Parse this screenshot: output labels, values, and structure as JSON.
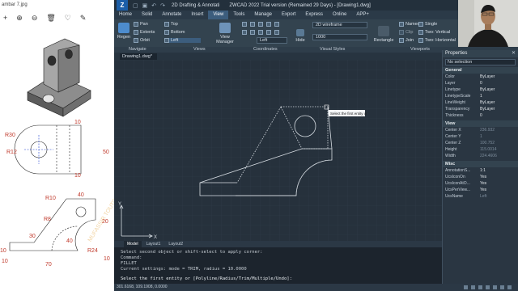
{
  "viewer": {
    "title": "ambar 7.jpg",
    "toolbar": [
      "+",
      "⊕",
      "⊖",
      "🗑",
      "♡",
      "✎"
    ]
  },
  "reference_drawing": {
    "dims": [
      "R30",
      "R12",
      "50",
      "10",
      "10",
      "R10",
      "40",
      "R8",
      "20",
      "30",
      "40",
      "10",
      "R24",
      "70",
      "10",
      "10"
    ],
    "watermark": "MUFASSIR TOUTOUR CHANNEL"
  },
  "cad": {
    "title": "ZWCAD 2022 Trial version (Remained 29 Days) - [Drawing1.dwg]",
    "workspace": "2D Drafting & Annotati",
    "quick_access": [
      "▢",
      "▣",
      "↶",
      "↷"
    ],
    "menu_tabs": [
      "Home",
      "Solid",
      "Annotate",
      "Insert",
      "View",
      "Tools",
      "Manage",
      "Export",
      "Express",
      "Online",
      "APP+"
    ],
    "active_tab": "View",
    "ribbon": {
      "navigate_big": "Regen",
      "navigate": [
        "Pan",
        "Extents",
        "Orbit"
      ],
      "views": [
        "Top",
        "Bottom",
        "Left"
      ],
      "view_manager": "View Manager",
      "coord_drop": "Left",
      "visual_style": "2D wireframe",
      "hide": "Hide",
      "hide_value": "1000",
      "viewports_big": "Rectangle",
      "viewports": [
        "Named",
        "Clip",
        "Join"
      ],
      "viewports_right": [
        "Single",
        "Two: Vertical",
        "Two: Horizontal"
      ]
    },
    "panel_names": [
      "Navigate",
      "Views",
      "Coordinates",
      "Visual Styles",
      "Viewports"
    ],
    "doc_tab": "Drawing1.dwg*",
    "tooltip": "Select the first entity or",
    "layout_tabs": [
      "Model",
      "Layout1",
      "Layout2"
    ],
    "command_lines": [
      "Select second object or shift-select to apply corner:",
      "Command:",
      "FILLET",
      "Current settings: mode = TRIM, radius = 10.0000"
    ],
    "command_prompt": "Select the first entity or [Polyline/Radius/Trim/Multiple/Undo]:",
    "status_coords": "301.6168, 109.1908, 0.0000",
    "ucs_x": "X",
    "ucs_y": "Y"
  },
  "properties": {
    "title": "Properties",
    "selection": "No selection",
    "sections": [
      {
        "name": "General",
        "rows": [
          {
            "k": "Color",
            "v": "ByLayer",
            "swatch": true
          },
          {
            "k": "Layer",
            "v": "0"
          },
          {
            "k": "Linetype",
            "v": "ByLayer"
          },
          {
            "k": "LinetypeScale",
            "v": "1"
          },
          {
            "k": "LineWeight",
            "v": "ByLayer"
          },
          {
            "k": "Transparency",
            "v": "ByLayer"
          },
          {
            "k": "Thickness",
            "v": "0"
          }
        ]
      },
      {
        "name": "View",
        "rows": [
          {
            "k": "Center X",
            "v": "236.932",
            "dim": true
          },
          {
            "k": "Center Y",
            "v": "1",
            "dim": true
          },
          {
            "k": "Center Z",
            "v": "100.752",
            "dim": true
          },
          {
            "k": "Height",
            "v": "115.0014",
            "dim": true
          },
          {
            "k": "Width",
            "v": "224.4606",
            "dim": true
          }
        ]
      },
      {
        "name": "Misc",
        "rows": [
          {
            "k": "AnnotationS...",
            "v": "1:1"
          },
          {
            "k": "UcsIconOn",
            "v": "Yes"
          },
          {
            "k": "UcsIconAtO...",
            "v": "Yes"
          },
          {
            "k": "UcsPerView...",
            "v": "Yes"
          },
          {
            "k": "UcsName",
            "v": "Left",
            "dim": true
          }
        ]
      }
    ]
  },
  "colors": {
    "canvas": "#26313c",
    "accent": "#3c5d7d",
    "drawing_line": "#d7dde3"
  }
}
